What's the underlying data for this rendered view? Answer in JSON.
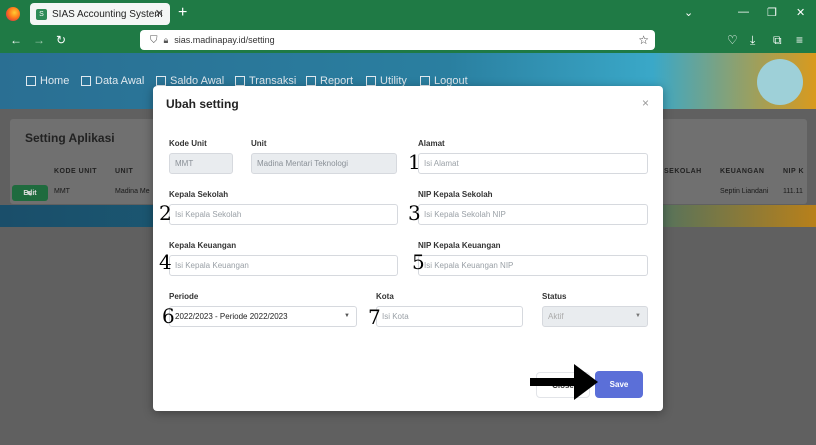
{
  "browser": {
    "tab_title": "SIAS Accounting System",
    "url": "sias.madinapay.id/setting"
  },
  "menu": [
    "Home",
    "Data Awal",
    "Saldo Awal",
    "Transaksi",
    "Report",
    "Utility",
    "Logout"
  ],
  "page": {
    "title": "Setting Aplikasi",
    "table": {
      "columns": [
        "KODE UNIT",
        "UNIT",
        "SEKOLAH",
        "KEUANGAN",
        "NIP K"
      ],
      "row": {
        "edit_label": "Edit",
        "kode_unit": "MMT",
        "unit": "Madina Me",
        "keuangan": "Septin Liandani",
        "nip": "111.11"
      }
    }
  },
  "modal": {
    "title": "Ubah setting",
    "close_symbol": "×",
    "kode_unit": {
      "label": "Kode Unit",
      "value": "MMT"
    },
    "unit": {
      "label": "Unit",
      "value": "Madina Mentari Teknologi"
    },
    "alamat": {
      "label": "Alamat",
      "placeholder": "Isi Alamat"
    },
    "kepala_sekolah": {
      "label": "Kepala Sekolah",
      "placeholder": "Isi Kepala Sekolah"
    },
    "nip_kepala_sekolah": {
      "label": "NIP Kepala Sekolah",
      "placeholder": "Isi Kepala Sekolah NIP"
    },
    "kepala_keuangan": {
      "label": "Kepala Keuangan",
      "placeholder": "Isi Kepala Keuangan"
    },
    "nip_kepala_keuangan": {
      "label": "NIP Kepala Keuangan",
      "placeholder": "Isi Kepala Keuangan NIP"
    },
    "periode": {
      "label": "Periode",
      "value": "2022/2023 - Periode 2022/2023"
    },
    "kota": {
      "label": "Kota",
      "placeholder": "Isi Kota"
    },
    "status": {
      "label": "Status",
      "value": "Aktif"
    },
    "close_label": "Close",
    "save_label": "Save"
  },
  "markers": [
    "1",
    "2",
    "3",
    "4",
    "5",
    "6",
    "7"
  ]
}
